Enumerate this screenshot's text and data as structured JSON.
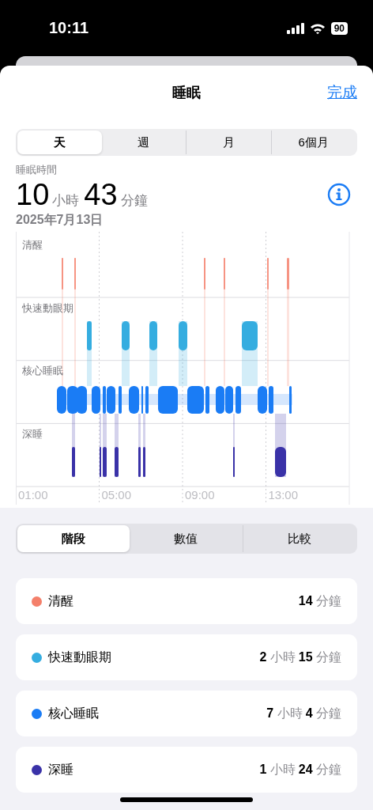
{
  "status_bar": {
    "time": "10:11",
    "battery": "90"
  },
  "header": {
    "title": "睡眠",
    "done": "完成"
  },
  "period_tabs": [
    {
      "label": "天",
      "selected": true
    },
    {
      "label": "週",
      "selected": false
    },
    {
      "label": "月",
      "selected": false
    },
    {
      "label": "6個月",
      "selected": false
    }
  ],
  "summary": {
    "label": "睡眠時間",
    "hours": "10",
    "hours_unit": "小時",
    "minutes": "43",
    "minutes_unit": "分鐘",
    "date": "2025年7月13日"
  },
  "chart": {
    "stage_labels": [
      "清醒",
      "快速動眼期",
      "核心睡眠",
      "深睡"
    ],
    "time_labels": [
      "01:00",
      "05:00",
      "09:00",
      "13:00"
    ]
  },
  "view_tabs": [
    {
      "label": "階段",
      "selected": true
    },
    {
      "label": "數值",
      "selected": false
    },
    {
      "label": "比較",
      "selected": false
    }
  ],
  "stages": [
    {
      "name": "清醒",
      "color": "#f4806b",
      "duration": [
        {
          "value": "14",
          "unit": "分鐘"
        }
      ]
    },
    {
      "name": "快速動眼期",
      "color": "#35ade0",
      "duration": [
        {
          "value": "2",
          "unit": "小時"
        },
        {
          "value": "15",
          "unit": "分鐘"
        }
      ]
    },
    {
      "name": "核心睡眠",
      "color": "#1a7cf5",
      "duration": [
        {
          "value": "7",
          "unit": "小時"
        },
        {
          "value": "4",
          "unit": "分鐘"
        }
      ]
    },
    {
      "name": "深睡",
      "color": "#3a32a8",
      "duration": [
        {
          "value": "1",
          "unit": "小時"
        },
        {
          "value": "24",
          "unit": "分鐘"
        }
      ]
    }
  ]
}
